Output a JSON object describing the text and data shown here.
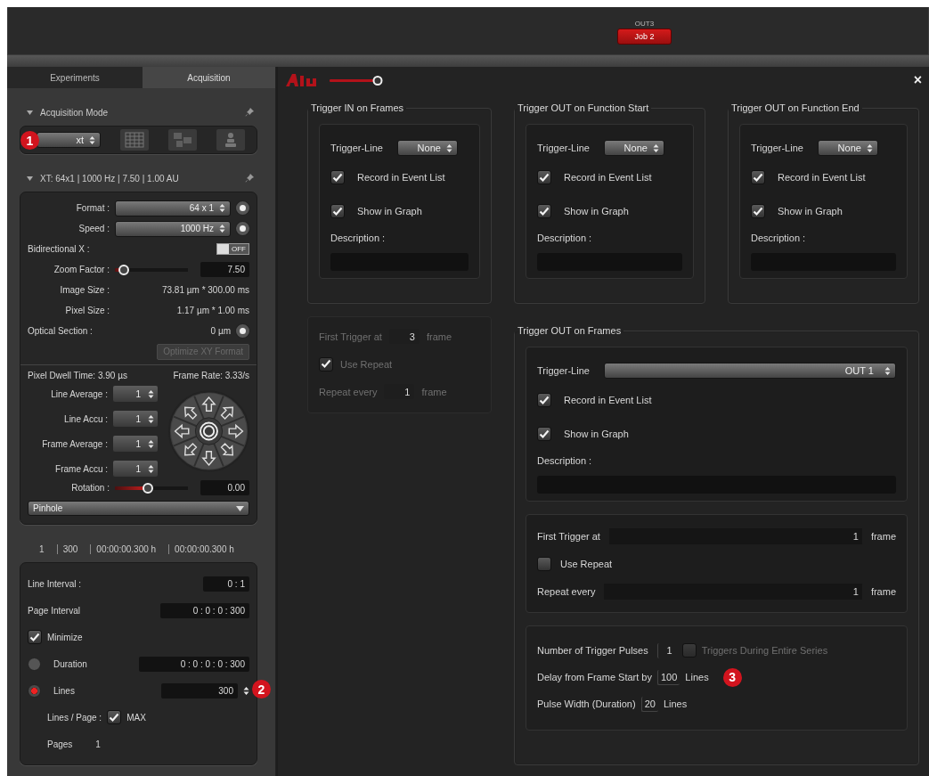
{
  "top_bar": {
    "output_label": "OUT3",
    "job_badge": "Job 2"
  },
  "left_panel": {
    "tabs": [
      {
        "label": "Experiments",
        "selected": false
      },
      {
        "label": "Acquisition",
        "selected": true
      }
    ],
    "acquisition_mode": {
      "title": "Acquisition Mode",
      "callout": "1",
      "mode": "xt",
      "buttons": [
        {
          "kind": "grid"
        },
        {
          "kind": "tiles"
        },
        {
          "kind": "stack"
        }
      ]
    },
    "scan": {
      "title": "XT: 64x1 | 1000 Hz | 7.50 | 1.00 AU",
      "format": {
        "label": "Format :",
        "value": "64 x 1"
      },
      "speed": {
        "label": "Speed :",
        "value": "1000 Hz"
      },
      "bidirectional": {
        "label": "Bidirectional X :",
        "on": false,
        "state_text": "OFF"
      },
      "zoom": {
        "label": "Zoom Factor :",
        "level": 0.12,
        "value": "7.50"
      },
      "image_size": {
        "label": "Image Size :",
        "value": "73.81 µm * 300.00 ms"
      },
      "pixel_size": {
        "label": "Pixel Size :",
        "value": "1.17 µm * 1.00 ms"
      },
      "optical_section": {
        "label": "Optical Section :",
        "value": "0 µm"
      },
      "optimize_button": {
        "label": "Optimize XY Format",
        "disabled": true
      },
      "pixel_dwell": "Pixel Dwell Time: 3.90 µs",
      "frame_rate": "Frame Rate: 3.33/s",
      "averaging": [
        {
          "label": "Line Average :",
          "value": "1"
        },
        {
          "label": "Line Accu :",
          "value": "1"
        },
        {
          "label": "Frame Average :",
          "value": "1"
        },
        {
          "label": "Frame Accu :",
          "value": "1"
        }
      ],
      "rotation": {
        "label": "Rotation :",
        "level": 0.45,
        "value": "0.00"
      },
      "pinhole": "Pinhole"
    },
    "timing": {
      "header": [
        "1",
        "300",
        "00:00:00.300 h",
        "00:00:00.300 h"
      ],
      "line_interval": {
        "label": "Line Interval :",
        "value": "0 : 1"
      },
      "page_interval": {
        "label": "Page Interval",
        "value": "0 : 0 : 0 : 300"
      },
      "minimize": {
        "label": "Minimize",
        "checked": true
      },
      "modes": [
        {
          "label": "Duration",
          "selected": false,
          "value": "0 : 0 : 0 : 0 : 300"
        },
        {
          "label": "Lines",
          "selected": true,
          "value": "300"
        }
      ],
      "callout": "2",
      "lines_per_page": {
        "label": "Lines / Page :",
        "checked": true,
        "max_label": "MAX"
      },
      "pages": {
        "label": "Pages",
        "value": "1"
      }
    }
  },
  "trigger_panel": {
    "close": "×",
    "groups": [
      {
        "title": "Trigger IN on Frames",
        "trigger_line_label": "Trigger-Line",
        "trigger_line": "None",
        "options": [
          {
            "label": "Record in Event List",
            "checked": true
          },
          {
            "label": "Show in Graph",
            "checked": true
          }
        ],
        "description_label": "Description :"
      },
      {
        "title": "Trigger OUT on Function Start",
        "trigger_line_label": "Trigger-Line",
        "trigger_line": "None",
        "options": [
          {
            "label": "Record in Event List",
            "checked": true
          },
          {
            "label": "Show in Graph",
            "checked": true
          }
        ],
        "description_label": "Description :"
      },
      {
        "title": "Trigger OUT on Function End",
        "trigger_line_label": "Trigger-Line",
        "trigger_line": "None",
        "options": [
          {
            "label": "Record in Event List",
            "checked": true
          },
          {
            "label": "Show in Graph",
            "checked": true
          }
        ],
        "description_label": "Description :"
      }
    ],
    "in_frames": {
      "disabled": true,
      "first_trigger": {
        "label": "First Trigger at",
        "value": "3",
        "unit": "frame"
      },
      "use_repeat": {
        "label": "Use Repeat",
        "checked": true
      },
      "repeat_every": {
        "label": "Repeat every",
        "value": "1",
        "unit": "frame"
      }
    },
    "out_frames": {
      "title": "Trigger OUT on Frames",
      "trigger_line_label": "Trigger-Line",
      "trigger_line": "OUT 1",
      "options": [
        {
          "label": "Record in Event List",
          "checked": true
        },
        {
          "label": "Show in Graph",
          "checked": true
        }
      ],
      "description_label": "Description :",
      "first_trigger": {
        "label": "First Trigger at",
        "value": "1",
        "unit": "frame"
      },
      "use_repeat": {
        "label": "Use Repeat",
        "checked": false
      },
      "repeat_every": {
        "label": "Repeat every",
        "value": "1",
        "unit": "frame"
      },
      "pulses": {
        "label": "Number of Trigger Pulses",
        "value": "1"
      },
      "entire_series": {
        "label": "Triggers During Entire Series",
        "checked": false,
        "disabled": true
      },
      "delay": {
        "label": "Delay from Frame Start by",
        "value": "100",
        "unit": "Lines"
      },
      "width": {
        "label": "Pulse Width (Duration)",
        "value": "20",
        "unit": "Lines"
      },
      "callout": "3"
    }
  }
}
